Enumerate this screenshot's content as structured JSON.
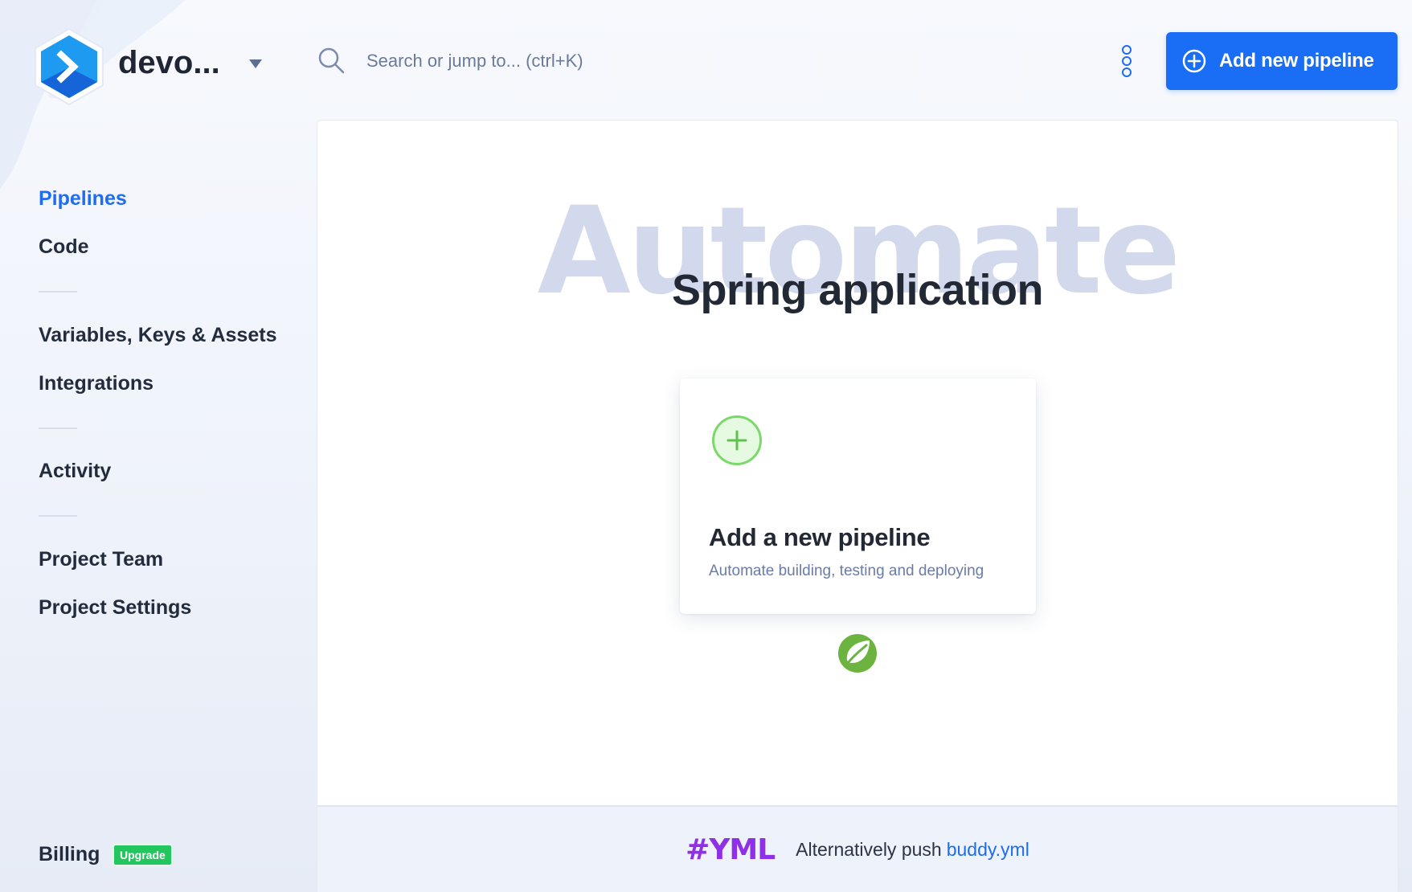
{
  "project": {
    "name": "devo..."
  },
  "sidebar": {
    "items": [
      {
        "label": "Pipelines",
        "active": true
      },
      {
        "label": "Code"
      },
      {
        "label": "Variables, Keys & Assets"
      },
      {
        "label": "Integrations"
      },
      {
        "label": "Activity"
      },
      {
        "label": "Project Team"
      },
      {
        "label": "Project Settings"
      },
      {
        "label": "Billing"
      }
    ],
    "billing_badge": "Upgrade"
  },
  "search": {
    "placeholder": "Search or jump to... (ctrl+K)"
  },
  "header": {
    "add_button_label": "Add new pipeline"
  },
  "main": {
    "watermark": "Automate",
    "title": "Spring application",
    "card": {
      "title": "Add a new pipeline",
      "subtitle": "Automate building, testing and deploying"
    },
    "footer": {
      "logo_text": "#YML",
      "text": "Alternatively push",
      "link": "buddy.yml"
    }
  },
  "colors": {
    "accent": "#1e6cf0",
    "badge": "#22c55e",
    "yml": "#8f2fe6",
    "spring": "#6db33f"
  }
}
